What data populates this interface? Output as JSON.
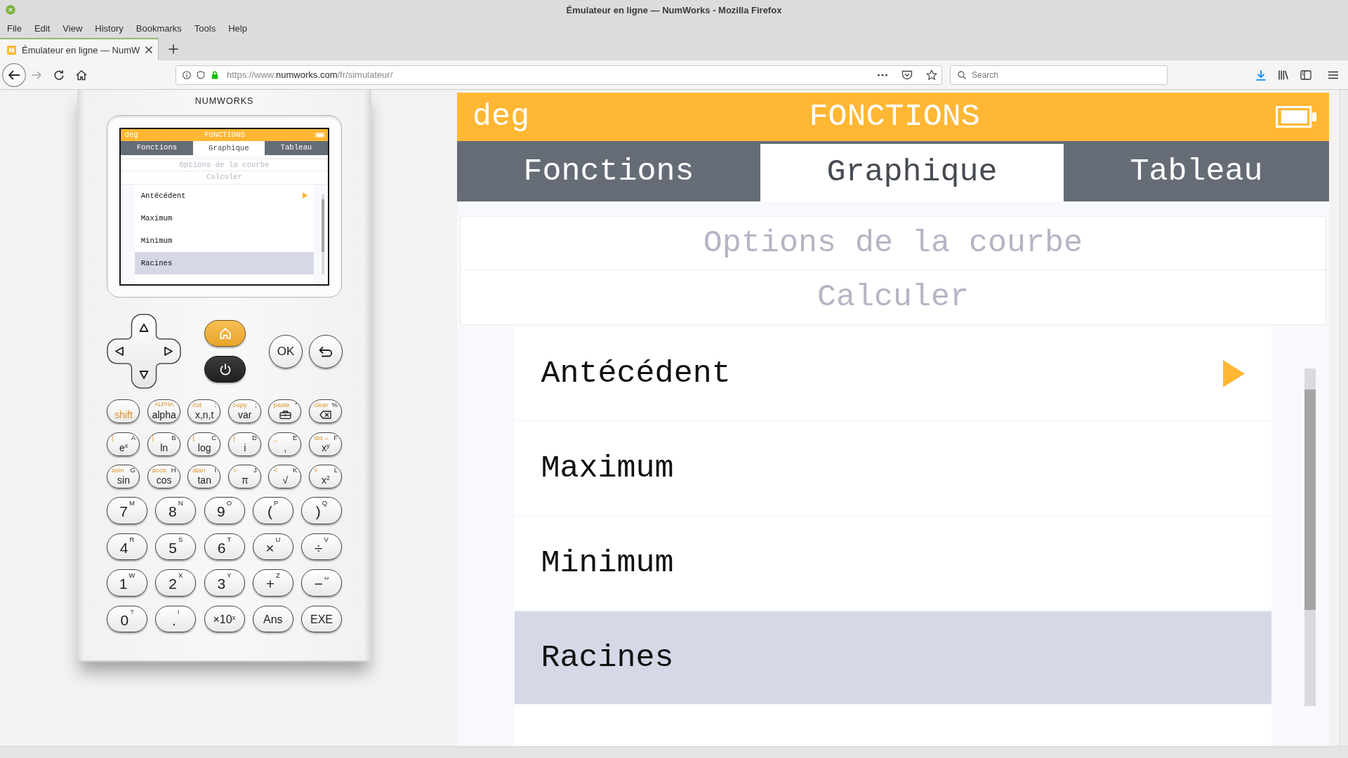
{
  "window": {
    "title": "Émulateur en ligne — NumWorks - Mozilla Firefox"
  },
  "menu_bar": [
    "File",
    "Edit",
    "View",
    "History",
    "Bookmarks",
    "Tools",
    "Help"
  ],
  "tabs": [
    {
      "label": "Émulateur en ligne — NumW",
      "selected": true
    }
  ],
  "toolbar": {
    "url": {
      "prefix": "https://www.",
      "host": "numworks.com",
      "path": "/fr/simulateur/"
    },
    "search": {
      "placeholder": "Search"
    }
  },
  "calculator": {
    "brand": "NUMWORKS",
    "screen": {
      "angle_unit": "deg",
      "title": "FONCTIONS",
      "tabs": [
        {
          "label": "Fonctions",
          "selected": false
        },
        {
          "label": "Graphique",
          "selected": true
        },
        {
          "label": "Tableau",
          "selected": false
        }
      ],
      "headers": [
        "Options de la courbe",
        "Calculer"
      ],
      "items": [
        {
          "label": "Antécédent",
          "submenu": true,
          "selected": false
        },
        {
          "label": "Maximum",
          "submenu": false,
          "selected": false
        },
        {
          "label": "Minimum",
          "submenu": false,
          "selected": false
        },
        {
          "label": "Racines",
          "submenu": false,
          "selected": true
        },
        {
          "submenu": false,
          "selected": false
        }
      ]
    },
    "ok_key": "OK",
    "function_keys": [
      [
        {
          "kind": "modifier",
          "label": "shift"
        },
        {
          "kind": "text",
          "label": "alpha",
          "shift": "ALPHA"
        },
        {
          "kind": "text",
          "label": "x,n,t",
          "shift": "cut",
          "alpha": ":"
        },
        {
          "kind": "text",
          "label": "var",
          "shift": "copy",
          "alpha": ";"
        },
        {
          "kind": "toolbox",
          "shift": "paste",
          "alpha": "\""
        },
        {
          "kind": "backspace",
          "shift": "clear",
          "alpha": "%"
        }
      ],
      [
        {
          "kind": "text",
          "label": "e$^{x}$",
          "shift": "[",
          "alpha": "A"
        },
        {
          "kind": "text",
          "label": "ln",
          "shift": "]",
          "alpha": "B"
        },
        {
          "kind": "text",
          "label": "log",
          "shift": "{",
          "alpha": "C"
        },
        {
          "kind": "text",
          "label": "i",
          "shift": "}",
          "alpha": "D"
        },
        {
          "kind": "text",
          "label": ",",
          "shift": "_",
          "alpha": "E"
        },
        {
          "kind": "text",
          "label": "x$^{y}$",
          "shift": "sto→",
          "alpha": "F"
        }
      ],
      [
        {
          "kind": "text",
          "label": "sin",
          "shift": "asin",
          "alpha": "G"
        },
        {
          "kind": "text",
          "label": "cos",
          "shift": "acos",
          "alpha": "H"
        },
        {
          "kind": "text",
          "label": "tan",
          "shift": "atan",
          "alpha": "I"
        },
        {
          "kind": "text",
          "label": "π",
          "shift": "=",
          "alpha": "J"
        },
        {
          "kind": "text",
          "label": "√",
          "shift": "<",
          "alpha": "K"
        },
        {
          "kind": "text",
          "label": "x$^{2}$",
          "shift": ">",
          "alpha": "L"
        }
      ]
    ],
    "number_keys": [
      [
        {
          "kind": "symbol",
          "label": "7",
          "alpha": "M"
        },
        {
          "kind": "symbol",
          "label": "8",
          "alpha": "N"
        },
        {
          "kind": "symbol",
          "label": "9",
          "alpha": "O"
        },
        {
          "kind": "symbol",
          "label": "(",
          "alpha": "P"
        },
        {
          "kind": "symbol",
          "label": ")",
          "alpha": "Q"
        }
      ],
      [
        {
          "kind": "symbol",
          "label": "4",
          "alpha": "R"
        },
        {
          "kind": "symbol",
          "label": "5",
          "alpha": "S"
        },
        {
          "kind": "symbol",
          "label": "6",
          "alpha": "T"
        },
        {
          "kind": "symbol",
          "label": "×",
          "alpha": "U"
        },
        {
          "kind": "symbol",
          "label": "÷",
          "alpha": "V"
        }
      ],
      [
        {
          "kind": "symbol",
          "label": "1",
          "alpha": "W"
        },
        {
          "kind": "symbol",
          "label": "2",
          "alpha": "X"
        },
        {
          "kind": "symbol",
          "label": "3",
          "alpha": "Y"
        },
        {
          "kind": "symbol",
          "label": "+",
          "alpha": "Z"
        },
        {
          "kind": "symbol",
          "label": "−",
          "alpha": "␣"
        }
      ],
      [
        {
          "kind": "symbol",
          "label": "0",
          "alpha": "?"
        },
        {
          "kind": "symbol",
          "label": ".",
          "alpha": "!"
        },
        {
          "kind": "word",
          "label": "×10$^{x}$"
        },
        {
          "kind": "word",
          "label": "Ans"
        },
        {
          "kind": "word",
          "label": "EXE"
        }
      ]
    ]
  },
  "emulator_screen": {
    "angle_unit": "deg",
    "title": "FONCTIONS",
    "tabs": [
      {
        "label": "Fonctions",
        "selected": false
      },
      {
        "label": "Graphique",
        "selected": true
      },
      {
        "label": "Tableau",
        "selected": false
      }
    ],
    "headers": [
      "Options de la courbe",
      "Calculer"
    ],
    "items": [
      {
        "label": "Antécédent",
        "submenu": true,
        "selected": false
      },
      {
        "label": "Maximum",
        "submenu": false,
        "selected": false
      },
      {
        "label": "Minimum",
        "submenu": false,
        "selected": false
      },
      {
        "label": "Racines",
        "submenu": false,
        "selected": true
      },
      {
        "submenu": false,
        "selected": false
      }
    ]
  }
}
